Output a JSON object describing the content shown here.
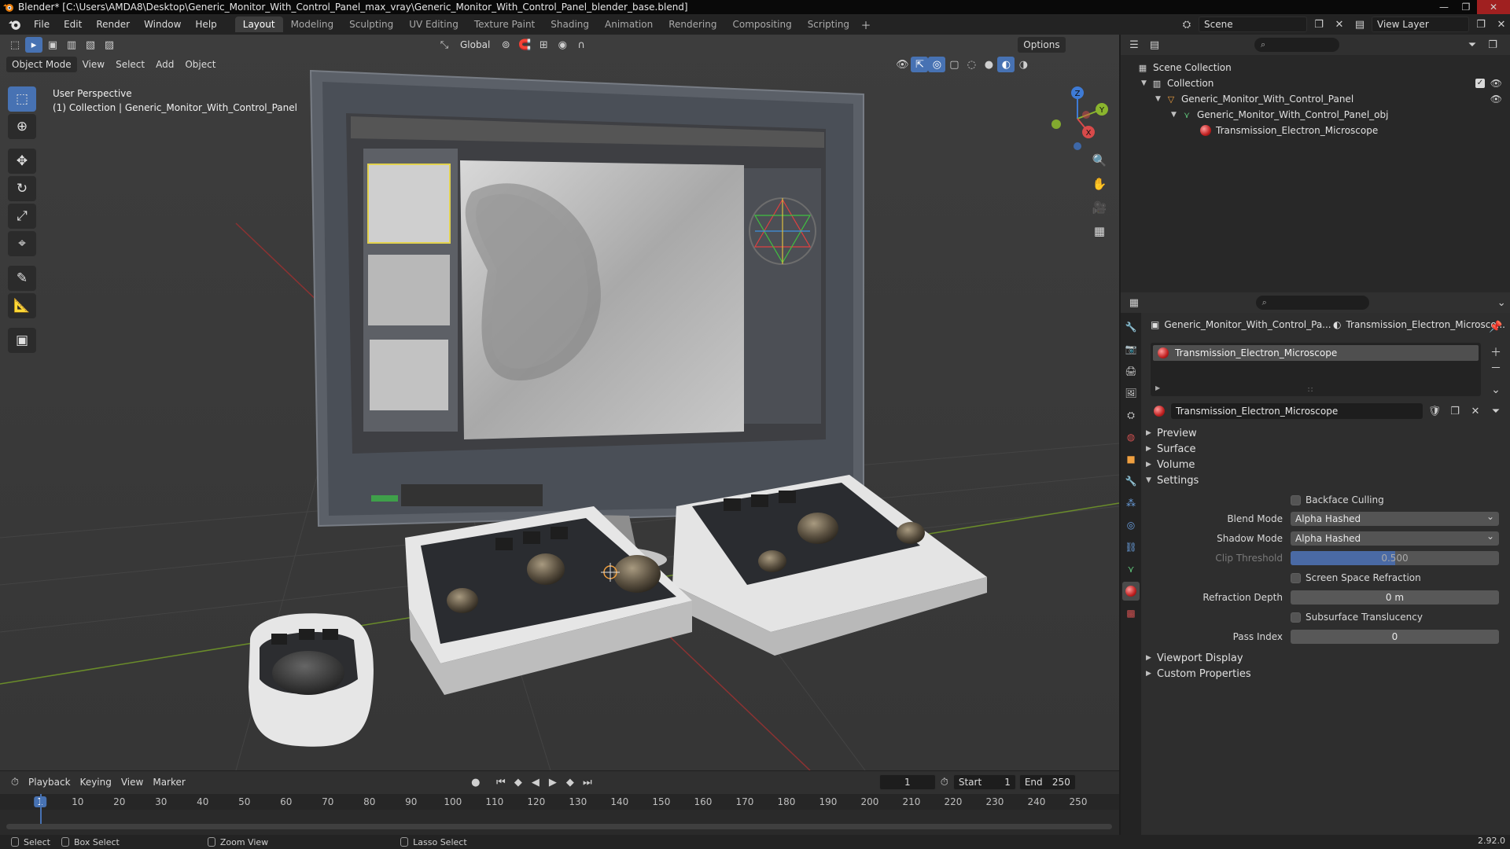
{
  "window": {
    "title": "Blender* [C:\\Users\\AMDA8\\Desktop\\Generic_Monitor_With_Control_Panel_max_vray\\Generic_Monitor_With_Control_Panel_blender_base.blend]"
  },
  "menu": [
    "File",
    "Edit",
    "Render",
    "Window",
    "Help"
  ],
  "workspaces": [
    "Layout",
    "Modeling",
    "Sculpting",
    "UV Editing",
    "Texture Paint",
    "Shading",
    "Animation",
    "Rendering",
    "Compositing",
    "Scripting"
  ],
  "active_workspace": "Layout",
  "scene": {
    "label": "Scene",
    "view_layer": "View Layer"
  },
  "viewport": {
    "mode": "Object Mode",
    "menus": [
      "View",
      "Select",
      "Add",
      "Object"
    ],
    "orientation": "Global",
    "options": "Options",
    "info_line1": "User Perspective",
    "info_line2": "(1) Collection | Generic_Monitor_With_Control_Panel",
    "gizmo": {
      "x": "X",
      "y": "Y",
      "z": "Z"
    }
  },
  "timeline": {
    "menus": [
      "Playback",
      "Keying",
      "View",
      "Marker"
    ],
    "current_frame": "1",
    "start_label": "Start",
    "start": "1",
    "end_label": "End",
    "end": "250",
    "ticks": [
      "1",
      "10",
      "20",
      "30",
      "40",
      "50",
      "60",
      "70",
      "80",
      "90",
      "100",
      "110",
      "120",
      "130",
      "140",
      "150",
      "160",
      "170",
      "180",
      "190",
      "200",
      "210",
      "220",
      "230",
      "240",
      "250"
    ]
  },
  "status": {
    "select": "Select",
    "box_select": "Box Select",
    "zoom_view": "Zoom View",
    "lasso_select": "Lasso Select",
    "version": "2.92.0"
  },
  "outliner": {
    "rows": [
      "Scene Collection",
      "Collection",
      "Generic_Monitor_With_Control_Panel",
      "Generic_Monitor_With_Control_Panel_obj",
      "Transmission_Electron_Microscope"
    ]
  },
  "properties": {
    "object_crumb": "Generic_Monitor_With_Control_Pa...",
    "material_crumb": "Transmission_Electron_Microsco...",
    "slot": "Transmission_Electron_Microscope",
    "material_name": "Transmission_Electron_Microscope",
    "panels": {
      "preview": "Preview",
      "surface": "Surface",
      "volume": "Volume",
      "settings": "Settings",
      "viewport_display": "Viewport Display",
      "custom_properties": "Custom Properties"
    },
    "settings": {
      "backface_culling": "Backface Culling",
      "blend_mode_label": "Blend Mode",
      "blend_mode": "Alpha Hashed",
      "shadow_mode_label": "Shadow Mode",
      "shadow_mode": "Alpha Hashed",
      "clip_threshold_label": "Clip Threshold",
      "clip_threshold": "0.500",
      "clip_threshold_fraction": 0.5,
      "ssr": "Screen Space Refraction",
      "refraction_depth_label": "Refraction Depth",
      "refraction_depth": "0 m",
      "sss": "Subsurface Translucency",
      "pass_index_label": "Pass Index",
      "pass_index": "0"
    }
  },
  "colors": {
    "accent": "#4772b3",
    "viewport_bg": "#393939",
    "material": "#c02020"
  }
}
